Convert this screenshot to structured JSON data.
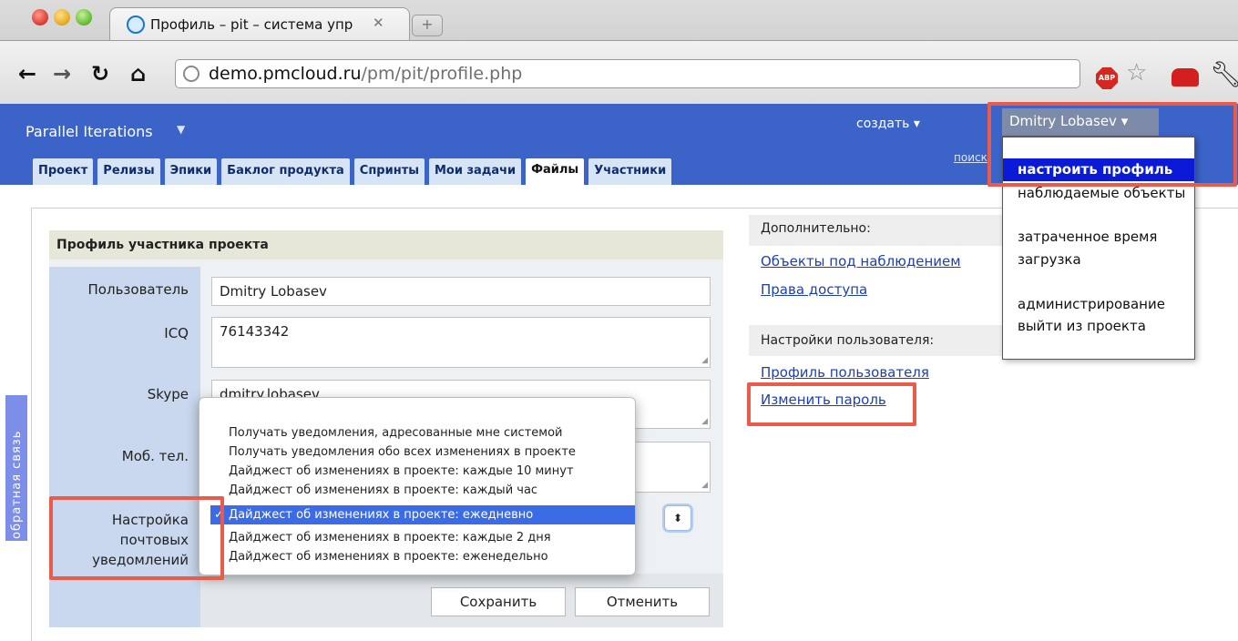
{
  "browser": {
    "tab_title": "Профиль – pit – система упр",
    "url_host": "demo.pmcloud.ru",
    "url_path": "/pm/pit/profile.php",
    "abp_label": "ABP",
    "icons": [
      "back-icon",
      "forward-icon",
      "reload-icon",
      "home-icon",
      "bookmark-star-icon",
      "wrench-icon"
    ]
  },
  "header": {
    "app_title": "Parallel Iterations",
    "create_label": "создать ▾",
    "search_label": "поиск",
    "tabs": [
      "Проект",
      "Релизы",
      "Эпики",
      "Баклог продукта",
      "Спринты",
      "Мои задачи",
      "Файлы",
      "Участники"
    ],
    "active_tab": "Файлы"
  },
  "user_menu": {
    "user_label": "Dmitry Lobasev ▾",
    "items": [
      "настроить профиль",
      "наблюдаемые объекты",
      "затраченное время",
      "загрузка",
      "администрирование",
      "выйти из проекта"
    ]
  },
  "form": {
    "title": "Профиль участника проекта",
    "labels": {
      "user": "Пользователь",
      "icq": "ICQ",
      "skype": "Skype",
      "phone": "Моб. тел.",
      "notify_1": "Настройка",
      "notify_2": "почтовых",
      "notify_3": "уведомлений"
    },
    "values": {
      "user": "Dmitry Lobasev",
      "icq": "76143342",
      "skype": "dmitry.lobasev",
      "phone": ""
    },
    "save_label": "Сохранить",
    "cancel_label": "Отменить",
    "notify_options": [
      "Получать уведомления, адресованные мне системой",
      "Получать уведомления обо всех изменениях в проекте",
      "Дайджест об изменениях в проекте: каждые 10 минут",
      "Дайджест об изменениях в проекте: каждый час",
      "Дайджест об изменениях в проекте: ежедневно",
      "Дайджест об изменениях в проекте: каждые 2 дня",
      "Дайджест об изменениях в проекте: еженедельно"
    ],
    "notify_selected": "Дайджест об изменениях в проекте: ежедневно"
  },
  "sidebar": {
    "extra_header": "Дополнительно:",
    "watched_link": "Объекты под наблюдением",
    "access_link": "Права доступа",
    "settings_header": "Настройки пользователя:",
    "profile_link": "Профиль пользователя",
    "password_link": "Изменить пароль"
  },
  "feedback": {
    "label": "обратная связь"
  },
  "colors": {
    "header_bg": "#3b63c8",
    "tab_bg": "#d6e4f6",
    "highlight_border": "#ea5b4a",
    "menu_selected": "#0a1ad6",
    "option_selected": "#3b6ce6"
  }
}
